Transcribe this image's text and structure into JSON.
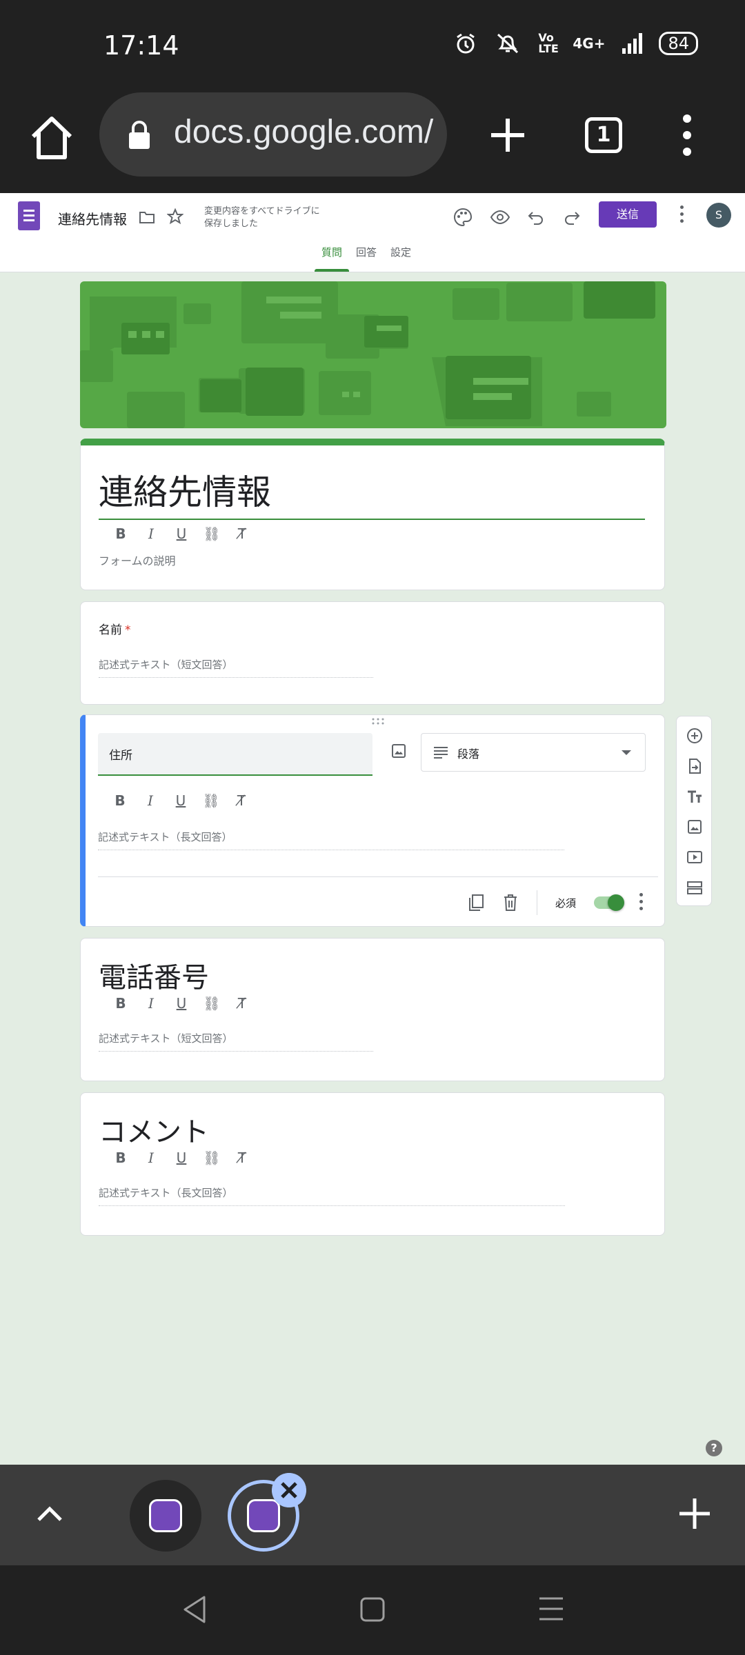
{
  "status_bar": {
    "time": "17:14",
    "network": "4G+",
    "volte": "Vo LTE",
    "battery": "84"
  },
  "browser": {
    "url": "docs.google.com/",
    "tab_count": "1"
  },
  "forms_header": {
    "doc_title": "連絡先情報",
    "save_status_line1": "変更内容をすべてドライブに",
    "save_status_line2": "保存しました",
    "send_label": "送信",
    "avatar_letter": "S",
    "tabs": [
      "質問",
      "回答",
      "設定"
    ],
    "active_tab": "質問"
  },
  "form": {
    "title": "連絡先情報",
    "description_placeholder": "フォームの説明",
    "questions": [
      {
        "label": "名前",
        "required": true,
        "required_mark": "*",
        "answer_hint": "記述式テキスト（短文回答）"
      },
      {
        "label": "住所",
        "type": "段落",
        "answer_hint": "記述式テキスト（長文回答）",
        "required_label": "必須",
        "required_on": true
      },
      {
        "label": "電話番号",
        "answer_hint": "記述式テキスト（短文回答）"
      },
      {
        "label": "コメント",
        "answer_hint": "記述式テキスト（長文回答）"
      }
    ]
  },
  "side_toolbar": [
    "add-question-icon",
    "import-questions-icon",
    "add-title-icon",
    "add-image-icon",
    "add-video-icon",
    "add-section-icon"
  ],
  "help": {
    "label": "?"
  },
  "colors": {
    "accent_green": "#388e3c",
    "forms_purple": "#673ab7",
    "active_question": "#4285f4",
    "banner_green": "#56a846"
  }
}
